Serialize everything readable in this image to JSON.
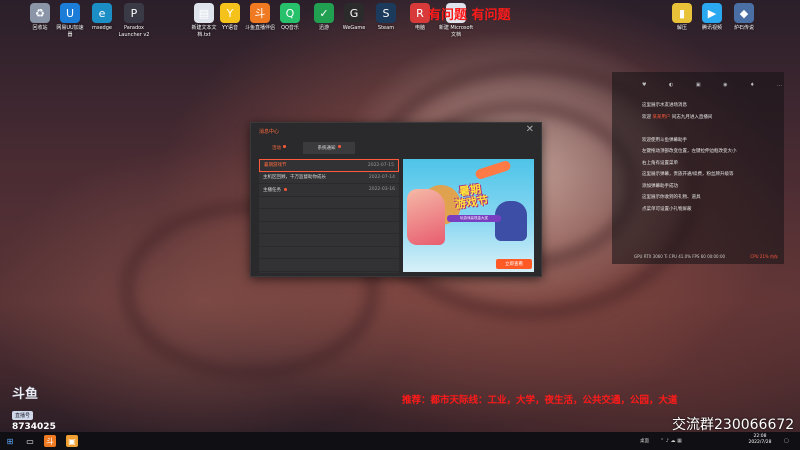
{
  "desktop_icons_top": [
    {
      "name": "recycle-bin-icon",
      "label": "回收站",
      "glyph": "♻",
      "color": "#8a95a8"
    },
    {
      "name": "netease-uu-icon",
      "label": "网易UU加速\n器",
      "glyph": "U",
      "color": "#1b7dd8"
    },
    {
      "name": "msedge-icon",
      "label": "msedge",
      "glyph": "e",
      "color": "#1c8ec6"
    },
    {
      "name": "paradox-launcher-icon",
      "label": "Paradox\nLauncher v2",
      "glyph": "P",
      "color": "#3a3a46"
    },
    {
      "name": "new-text-doc-icon",
      "label": "新建文本文\n档.txt",
      "glyph": "▤",
      "color": "#dfe4ec"
    },
    {
      "name": "yy-voice-icon",
      "label": "YY语音",
      "glyph": "Y",
      "color": "#f4c21a"
    },
    {
      "name": "douyu-companion-icon",
      "label": "斗鱼直播伴侣",
      "glyph": "斗",
      "color": "#f07a22"
    },
    {
      "name": "qq-browser-icon",
      "label": "QQ音乐",
      "glyph": "Q",
      "color": "#27c16b"
    },
    {
      "name": "pvz-icon",
      "label": "迅游",
      "glyph": "✓",
      "color": "#22a052"
    },
    {
      "name": "wegame-icon",
      "label": "WeGame",
      "glyph": "G",
      "color": "#2b2b2b"
    },
    {
      "name": "steam-icon",
      "label": "Steam",
      "glyph": "S",
      "color": "#1b3a5c"
    },
    {
      "name": "rockstar-icon",
      "label": "电脑",
      "glyph": "R",
      "color": "#d83a3a"
    },
    {
      "name": "new-doc-icon",
      "label": "新建 Microsoft\n文档",
      "glyph": "▤",
      "color": "#dfe4ec"
    }
  ],
  "desktop_icons_right": [
    {
      "name": "folder-icon",
      "label": "解压",
      "glyph": "▮",
      "color": "#e8c238"
    },
    {
      "name": "tencent-video-icon",
      "label": "腾讯视频",
      "glyph": "▶",
      "color": "#2aa8f0"
    },
    {
      "name": "app-icon",
      "label": "炉石传说",
      "glyph": "◆",
      "color": "#4a6fa5"
    }
  ],
  "red_overlay": {
    "top_text": "有问题  有问题",
    "bottom_text": "推荐：都市天际线：工业，大学，夜生活，公共交通，公园，大道"
  },
  "right_panel": {
    "icons": [
      "♥",
      "◐",
      "▣",
      "◉",
      "♦",
      "…"
    ],
    "lines": [
      {
        "pre": "这里展示水友进场消息",
        "hl": "",
        "post": ""
      },
      {
        "pre": "欢迎 ",
        "hl": "某某用户",
        "post": " 同志九月进入直播间"
      },
      {
        "pre": "",
        "hl": "",
        "post": ""
      },
      {
        "pre": "欢迎使用斗鱼弹幕助手",
        "hl": "",
        "post": ""
      },
      {
        "pre": "左键拖动顶部改变位置，左键拉伸边框改变大小",
        "hl": "",
        "post": ""
      },
      {
        "pre": "右上角有设置菜单",
        "hl": "",
        "post": ""
      },
      {
        "pre": "这里展示弹幕，贵族开通/续费，粉丝牌升级等",
        "hl": "",
        "post": ""
      },
      {
        "pre": "添加弹幕助手成功",
        "hl": "",
        "post": ""
      },
      {
        "pre": "这里展示你收到的礼物、道具",
        "hl": "",
        "post": ""
      },
      {
        "pre": "点菜单可设置小礼物屏蔽",
        "hl": "",
        "post": ""
      }
    ],
    "status": "GPU RTX 3060 Ti  CPU 41.0%  FPS 60  00:00:00",
    "status_right": "CPU 21% 内存"
  },
  "dialog": {
    "title": "消息中心",
    "close": "✕",
    "tabs": [
      "活动",
      "系统通知"
    ],
    "rows": [
      {
        "title": "暑期游戏节",
        "date": "2022-07-15",
        "dot": false,
        "selected": true
      },
      {
        "title": "主机区回顾，千万监督助你成长",
        "date": "2022-07-14",
        "dot": false,
        "selected": false
      },
      {
        "title": "主播任务",
        "date": "2022-03-16",
        "dot": true,
        "selected": false
      },
      {
        "title": "",
        "date": "",
        "dot": false,
        "selected": false
      },
      {
        "title": "",
        "date": "",
        "dot": false,
        "selected": false
      },
      {
        "title": "",
        "date": "",
        "dot": false,
        "selected": false
      },
      {
        "title": "",
        "date": "",
        "dot": false,
        "selected": false
      },
      {
        "title": "",
        "date": "",
        "dot": false,
        "selected": false
      },
      {
        "title": "",
        "date": "",
        "dot": false,
        "selected": false
      }
    ],
    "banner": {
      "title": "暑期\n游戏节",
      "subtitle": "玩游戏赢现金大奖",
      "button": "立即查看"
    }
  },
  "logo": {
    "brand": "斗鱼",
    "tag": "直播号",
    "room": "8734025"
  },
  "qq_group": "交流群230066672",
  "taskbar": {
    "start_icon": "windows-icon",
    "desktop_label": "桌面",
    "time": "22:08",
    "date": "2022/7/28"
  }
}
